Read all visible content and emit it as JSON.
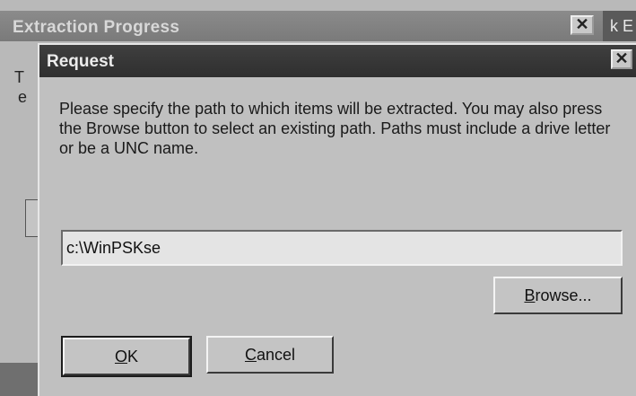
{
  "background_window": {
    "title": "Extraction Progress",
    "close_glyph": "✕",
    "right_strip_text": "k E",
    "side_letters": [
      "T",
      "e"
    ]
  },
  "dialog": {
    "title": "Request",
    "close_glyph": "✕",
    "message": "Please specify the path to which items will be extracted.  You may also press the Browse button to select an existing path.  Paths must include a drive letter or be a UNC name.",
    "path_value": "c:\\WinPSKse",
    "buttons": {
      "browse": {
        "mnemonic": "B",
        "rest": "rowse..."
      },
      "ok": {
        "mnemonic": "O",
        "rest": "K"
      },
      "cancel": {
        "mnemonic": "C",
        "rest": "ancel"
      }
    }
  }
}
